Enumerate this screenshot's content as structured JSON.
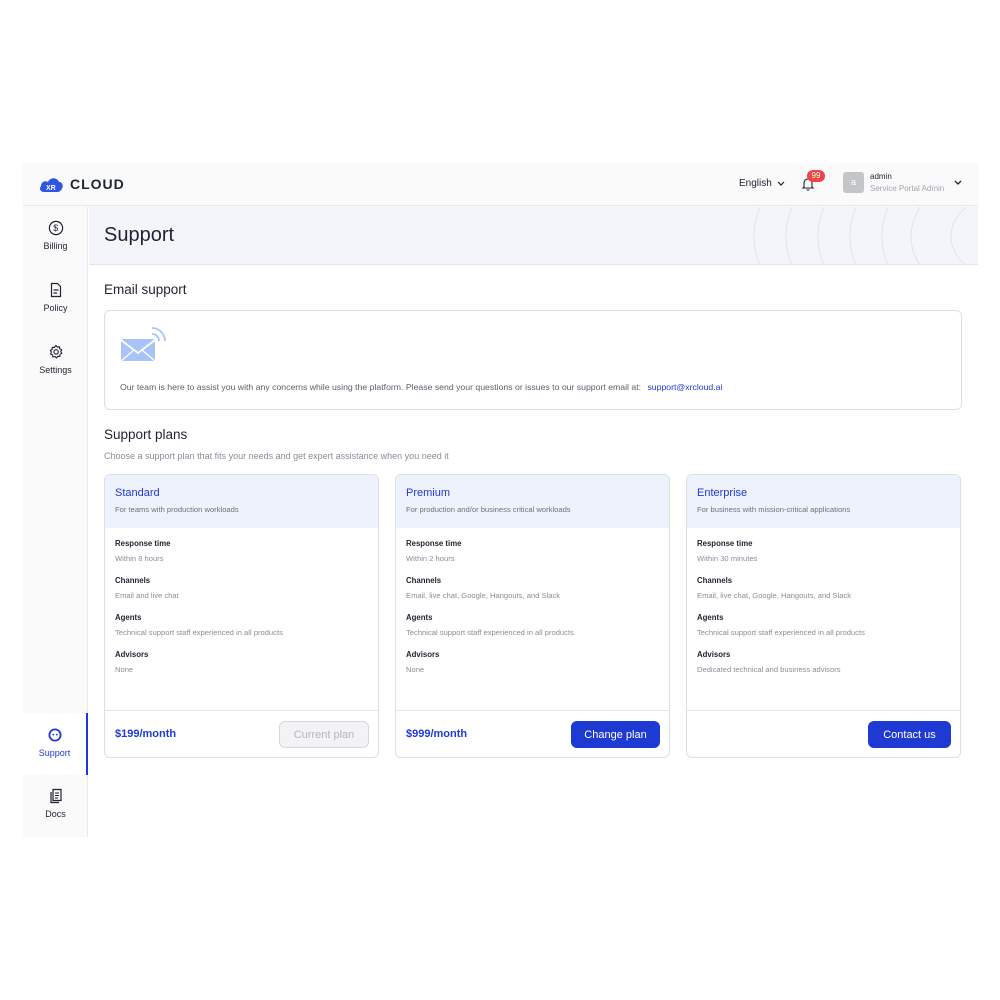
{
  "brand": {
    "logo_text": "CLOUD",
    "logo_mark": "XR",
    "accent": "#1e3ad2"
  },
  "header": {
    "language": "English",
    "notifications_count": "99",
    "user": {
      "avatar_letter": "a",
      "name": "admin",
      "role": "Service Portal Admin"
    }
  },
  "sidebar": {
    "items": [
      {
        "label": "Billing",
        "icon": "dollar-circle-icon"
      },
      {
        "label": "Policy",
        "icon": "document-icon"
      },
      {
        "label": "Settings",
        "icon": "gear-icon"
      },
      {
        "label": "Support",
        "icon": "support-face-icon",
        "active": true
      },
      {
        "label": "Docs",
        "icon": "docs-icon"
      }
    ]
  },
  "page": {
    "title": "Support"
  },
  "email_support": {
    "title": "Email support",
    "text": "Our team is here to assist you with any concerns while using the platform. Please send your questions or issues to our support email at:",
    "email": "support@xrcloud.ai"
  },
  "support_plans": {
    "title": "Support plans",
    "subtitle": "Choose a support plan that fits your needs and get expert assistance when you need it",
    "plans": [
      {
        "name": "Standard",
        "description": "For teams with production workloads",
        "response_label": "Response time",
        "response": "Within 8 hours",
        "channels_label": "Channels",
        "channels": "Email and live chat",
        "agents_label": "Agents",
        "agents": "Technical support staff experienced in all products",
        "advisors_label": "Advisors",
        "advisors": "None",
        "price": "$199/month",
        "button": "Current plan"
      },
      {
        "name": "Premium",
        "description": "For production and/or business critical workloads",
        "response_label": "Response time",
        "response": "Within 2 hours",
        "channels_label": "Channels",
        "channels": "Email, live chat, Google, Hangouts, and Slack",
        "agents_label": "Agents",
        "agents": "Technical support staff experienced in all products",
        "advisors_label": "Advisors",
        "advisors": "None",
        "price": "$999/month",
        "button": "Change plan"
      },
      {
        "name": "Enterprise",
        "description": "For business with mission-critical applications",
        "response_label": "Response time",
        "response": "Within 30 minutes",
        "channels_label": "Channels",
        "channels": "Email, live chat, Google, Hangouts, and Slack",
        "agents_label": "Agents",
        "agents": "Technical support staff experienced in all products",
        "advisors_label": "Advisors",
        "advisors": "Dedicated technical and business advisors",
        "price": "",
        "button": "Contact us"
      }
    ]
  }
}
